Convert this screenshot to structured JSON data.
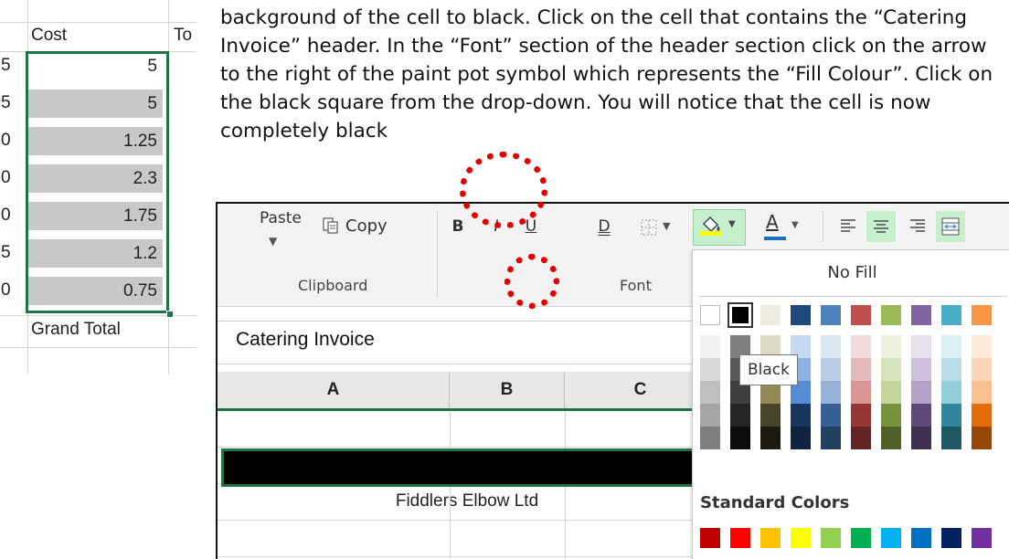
{
  "left_sheet": {
    "cost_header": "Cost",
    "next_header_fragment": "To",
    "row_keys": [
      "5",
      "5",
      "0",
      "0",
      "0",
      "5",
      "0"
    ],
    "cost_values": [
      "5",
      "5",
      "1.25",
      "2.3",
      "1.75",
      "1.2",
      "0.75"
    ],
    "grand_total": "Grand Total"
  },
  "instructions": {
    "text": "background of the cell to black. Click on the cell that contains the “Catering Invoice” header. In the “Font” section of the header section click on the arrow to the right of the paint pot symbol which represents the “Fill Colour”. Click on the black square from the drop-down. You will notice that the cell is now completely black"
  },
  "ribbon": {
    "paste_label": "Paste",
    "copy_label": "Copy",
    "clipboard_group": "Clipboard",
    "font_group": "Font",
    "bold": "B",
    "italic": "I",
    "underline": "U",
    "double_underline": "D",
    "font_color": "A"
  },
  "formula_bar": {
    "value": "Catering Invoice"
  },
  "grid": {
    "columns": [
      "A",
      "B",
      "C"
    ],
    "company_row": "Fiddlers Elbow Ltd"
  },
  "fill_dropdown": {
    "no_fill": "No Fill",
    "tooltip": "Black",
    "standard_colors_label": "Standard Colors",
    "theme_top": [
      "#ffffff",
      "#000000",
      "#eeece1",
      "#1f497d",
      "#4f81bd",
      "#c0504d",
      "#9bbb59",
      "#8064a2",
      "#4bacc6",
      "#f79646"
    ],
    "theme_shades": [
      [
        "#f2f2f2",
        "#7f7f7f",
        "#ddd9c3",
        "#c6d9f0",
        "#dbe5f1",
        "#f2dcdb",
        "#ebf1dd",
        "#e5e0ec",
        "#dbeef3",
        "#fdeada"
      ],
      [
        "#d8d8d8",
        "#595959",
        "#c4bd97",
        "#8db3e2",
        "#b8cce4",
        "#e5b9b7",
        "#d7e3bc",
        "#ccc1d9",
        "#b7dde8",
        "#fbd5b5"
      ],
      [
        "#bfbfbf",
        "#3f3f3f",
        "#938953",
        "#548dd4",
        "#95b3d7",
        "#d99694",
        "#c3d69b",
        "#b2a2c7",
        "#92cddc",
        "#fac08f"
      ],
      [
        "#a5a5a5",
        "#262626",
        "#494429",
        "#17365d",
        "#366092",
        "#953734",
        "#76923c",
        "#5f497a",
        "#31859b",
        "#e36c09"
      ],
      [
        "#7f7f7f",
        "#0c0c0c",
        "#1d1b10",
        "#0f243e",
        "#244061",
        "#632423",
        "#4f6128",
        "#3f3151",
        "#205867",
        "#974806"
      ]
    ],
    "standard": [
      "#c00000",
      "#ff0000",
      "#ffc000",
      "#ffff00",
      "#92d050",
      "#00b050",
      "#00b0f0",
      "#0070c0",
      "#002060",
      "#7030a0"
    ]
  },
  "colors": {
    "excel_green": "#217346",
    "annotation_red": "#e00000",
    "fill_button_bg": "#c6efce"
  }
}
